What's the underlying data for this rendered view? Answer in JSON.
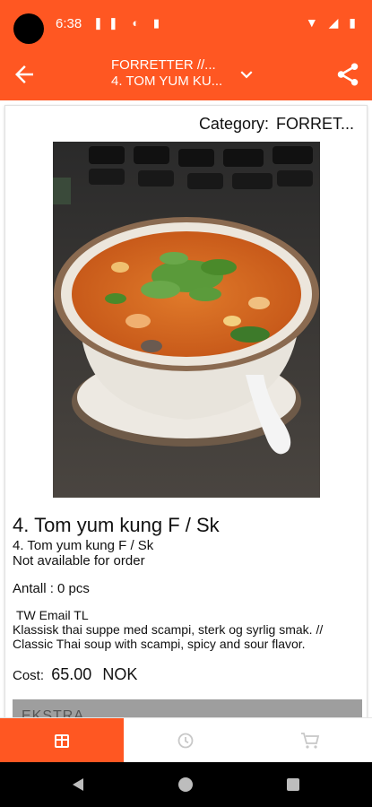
{
  "status_bar": {
    "time": "6:38",
    "icons_left": [
      "pause-icon",
      "app-notification-icon",
      "sd-card-icon"
    ],
    "icons_right": [
      "wifi-icon",
      "signal-icon",
      "battery-icon"
    ]
  },
  "app_bar": {
    "title_line1": "FORRETTER //...",
    "title_line2": "4. TOM YUM KU...",
    "back_icon": "arrow-left-icon",
    "dropdown_icon": "chevron-down-icon",
    "share_icon": "share-icon",
    "background_color": "#ff5722"
  },
  "item": {
    "category_label": "Category:",
    "category_value": "FORRET...",
    "title": "4. Tom yum kung F / Sk",
    "subtitle": "4. Tom yum kung F / Sk",
    "availability": "Not available for order",
    "quantity": "Antall : 0 pcs",
    "tags": "TW Email TL",
    "description": "Klassisk thai suppe med scampi, sterk og syrlig smak. // Classic Thai soup with scampi, spicy and sour flavor.",
    "cost_label": "Cost:",
    "cost_value": "65.00",
    "currency": "NOK",
    "extra_section_label": "EKSTRA"
  },
  "bottom_nav": {
    "items": [
      {
        "icon": "menu-grid-icon",
        "active": true
      },
      {
        "icon": "history-clock-icon",
        "active": false
      },
      {
        "icon": "cart-icon",
        "active": false
      }
    ],
    "active_color": "#ff5722"
  },
  "system_nav": {
    "items": [
      "back-triangle-icon",
      "home-circle-icon",
      "recents-square-icon"
    ]
  }
}
